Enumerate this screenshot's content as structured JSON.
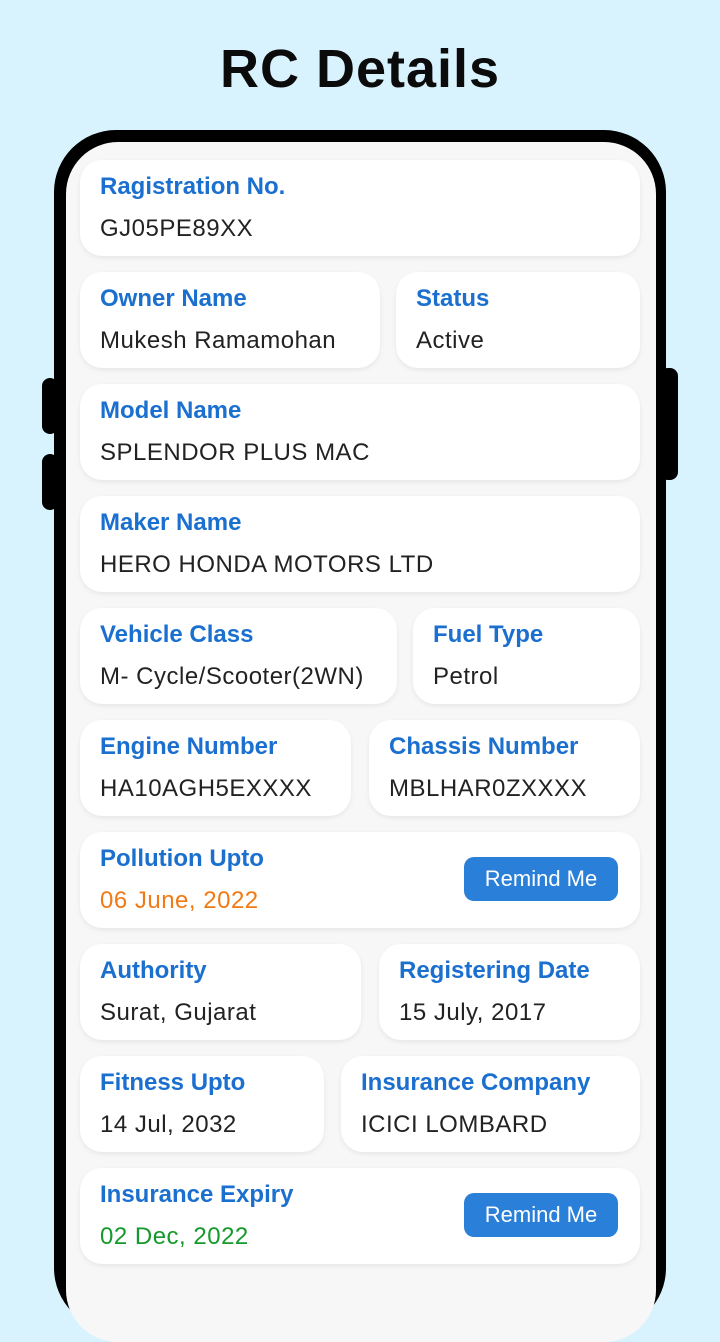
{
  "page_title": "RC Details",
  "colors": {
    "background": "#d8f3fe",
    "label": "#1a6fcf",
    "value": "#222222",
    "pollution_date": "#f07a15",
    "insurance_date": "#149a2c",
    "button": "#2a7fd8"
  },
  "fields": {
    "registration": {
      "label": "Ragistration No.",
      "value": "GJ05PE89XX"
    },
    "owner": {
      "label": "Owner Name",
      "value": "Mukesh Ramamohan"
    },
    "status": {
      "label": "Status",
      "value": "Active"
    },
    "model": {
      "label": "Model Name",
      "value": "SPLENDOR PLUS MAC"
    },
    "maker": {
      "label": "Maker Name",
      "value": "HERO HONDA MOTORS LTD"
    },
    "vehicle_class": {
      "label": "Vehicle Class",
      "value": "M- Cycle/Scooter(2WN)"
    },
    "fuel_type": {
      "label": "Fuel Type",
      "value": "Petrol"
    },
    "engine_number": {
      "label": "Engine Number",
      "value": "HA10AGH5EXXXX"
    },
    "chassis_number": {
      "label": "Chassis Number",
      "value": "MBLHAR0ZXXXX"
    },
    "pollution": {
      "label": "Pollution Upto",
      "value": "06 June, 2022",
      "button": "Remind Me"
    },
    "authority": {
      "label": "Authority",
      "value": "Surat, Gujarat"
    },
    "registering_date": {
      "label": "Registering Date",
      "value": "15 July, 2017"
    },
    "fitness": {
      "label": "Fitness Upto",
      "value": "14 Jul, 2032"
    },
    "insurance_company": {
      "label": "Insurance Company",
      "value": "ICICI LOMBARD"
    },
    "insurance_expiry": {
      "label": "Insurance Expiry",
      "value": "02 Dec, 2022",
      "button": "Remind Me"
    }
  }
}
